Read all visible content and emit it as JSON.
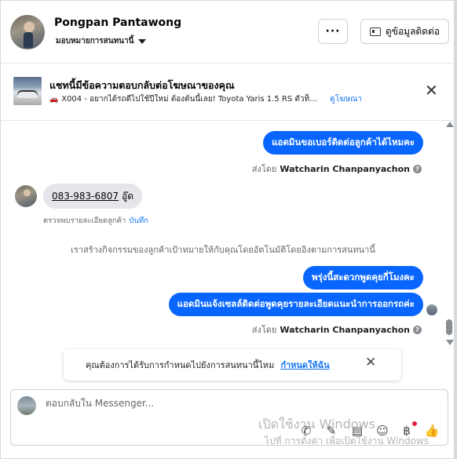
{
  "header": {
    "contact_name": "Pongpan Pantawong",
    "assign_label": "มอบหมายการสนทนานี้",
    "more_label": "···",
    "view_contact_label": "ดูข้อมูลติดต่อ"
  },
  "ad_banner": {
    "title": "แชทนี้มีข้อความตอบกลับต่อโฆษณาของคุณ",
    "ad_text": "X004 - อยากได้รถดีไปใช้ปีใหม่ ต้องต้นนี้เลย! Toyota Yaris 1.5 RS ตัวท็อ...",
    "view_ad_label": "ดูโฆษณา",
    "close": "✕"
  },
  "messages": {
    "out_1": "แอดมินขอเบอร์ติดต่อลูกค้าได้ไหมคะ",
    "sent_by_prefix": "ส่งโดย",
    "sent_by_name": "Watcharin Chanpanyachon",
    "in_phone": "083-983-6807",
    "in_suffix": "อู๊ด",
    "note_prefix": "ตรวจพบรายละเอียดลูกค้า",
    "note_link": "บันทึก",
    "system": "เราสร้างกิจกรรมของลูกค้าเป้าหมายให้กับคุณโดยอัตโนมัติโดยอิงตามการสนทนานี้",
    "out_2": "พรุ่งนี้สะดวกพูดคุยกี่โมงคะ",
    "out_3": "แอดมินแจ้งเซลล์ติดต่อพูดคุยรายละเอียดแนะนำการออกรถค่ะ",
    "info_glyph": "?"
  },
  "tip": {
    "text": "คุณต้องการได้รับการกำหนดไปยังการสนทนานี้ไหม",
    "link": "กำหนดให้ฉัน",
    "close": "✕"
  },
  "composer": {
    "placeholder": "ตอบกลับใน Messenger...",
    "icons": [
      "phone-icon",
      "attachment-icon",
      "quick-reply-icon",
      "emoji-icon",
      "payment-icon",
      "like-icon"
    ],
    "glyphs": {
      "phone": "✆",
      "attach": "✎",
      "quick": "▤",
      "emoji": "☺",
      "payment": "฿",
      "like": "👍"
    }
  },
  "watermark": {
    "line1": "เปิดใช้งาน Windows",
    "line2": "ไปที่ การตั้งค่า เพื่อเปิดใช้งาน Windows"
  },
  "colors": {
    "accent": "#0866ff",
    "link": "#1877f2",
    "bubble_in": "#e4e6eb"
  }
}
